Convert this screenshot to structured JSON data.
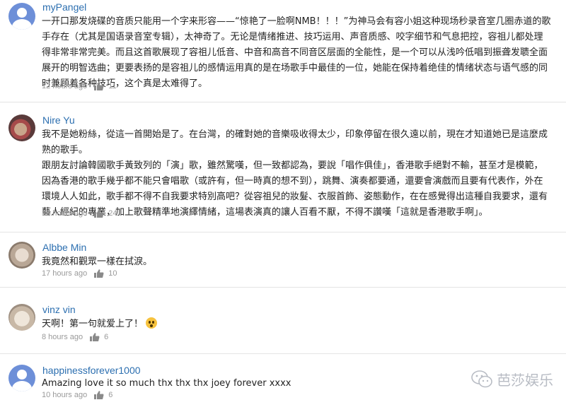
{
  "comments": [
    {
      "username": "myPangel",
      "avatar": "default-avatar",
      "text": "一开口那发烧碟的音质只能用一个字来形容——“惊艳了一脸啊NMB！！！”为神马会有容小姐这种现场秒录音室几圈赤道的歌手存在（尤其是国语录音室专辑），太神奇了。无论是情绪推进、技巧运用、声音质感、咬字细节和气息把控，容祖儿都处理得非常非常完美。而且这首歌展现了容祖儿低音、中音和高音不同音区层面的全能性，是一个可以从浅吟低唱到振聋发聩全面展开的明智选曲；更要表扬的是容祖儿的感情运用真的是在场歌手中最佳的一位，她能在保持着绝佳的情绪状态与语气感的同时兼顾着各种技巧，这个真是太难得了。",
      "time": "12 hours ago",
      "likes": "11"
    },
    {
      "username": "Nire Yu",
      "avatar": "photo-avatar",
      "text_lines": [
        "我不是她粉絲，從這一首開始是了。在台灣，的確對她的音樂吸收得太少，印象停留在很久遠以前，現在才知道她已是這麼成熟的歌手。",
        "跟朋友討論韓國歌手黃致列的「演」歌，雖然驚嘆，但一致都認為，要說「唱作俱佳」，香港歌手絕對不輸，甚至才是模範，因為香港的歌手幾乎都不能只會唱歌（或許有，但一時真的想不到），跳舞、演奏都要通，還要會演戲而且要有代表作，外在環境人人如此，歌手都不得不自我要求特別高吧？從容祖兒的妝髮、衣服首飾、姿態動作，在在感覺得出這種自我要求，還有藝人經紀的專業，加上歌聲精準地演繹情緒，這場表演真的讓人百看不厭，不得不讚嘆「這就是香港歌手啊」。"
      ],
      "time": "16 hours ago",
      "likes": "24"
    },
    {
      "username": "Albbe Min",
      "avatar": "photo-avatar",
      "text": "我竟然和觀眾一樣在拭淚。",
      "time": "17 hours ago",
      "likes": "10"
    },
    {
      "username": "vinz vin",
      "avatar": "photo-avatar",
      "text": "天啊！第一句就爱上了！",
      "emoji": "screaming-face-emoji",
      "time": "8 hours ago",
      "likes": "6"
    },
    {
      "username": "happinessforever1000",
      "avatar": "default-avatar",
      "text": "Amazing love it so much thx thx thx joey forever xxxx",
      "time": "10 hours ago",
      "likes": "6"
    }
  ],
  "watermark": {
    "text": "芭莎娱乐",
    "icon": "wechat-icon"
  },
  "colors": {
    "username": "#2c6fb0",
    "meta": "#9a9a9a",
    "default_avatar": "#6d8fd8"
  }
}
